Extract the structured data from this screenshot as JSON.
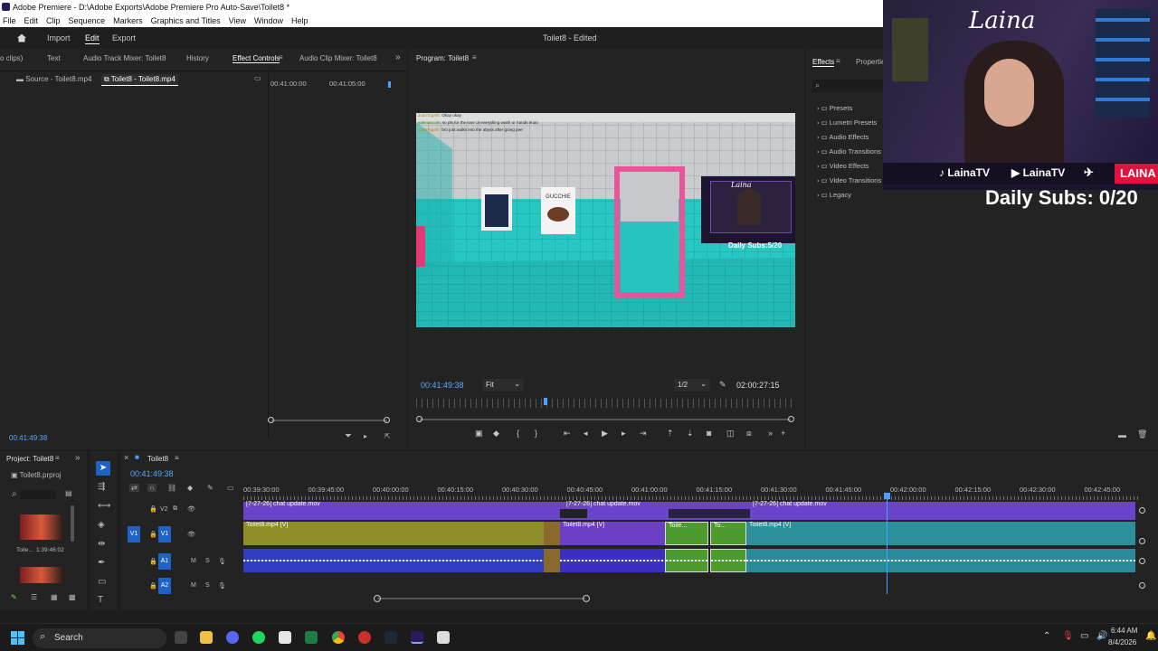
{
  "window": {
    "title": "Adobe Premiere - D:\\Adobe Exports\\Adobe Premiere Pro Auto-Save\\Toilet8 *"
  },
  "menu": [
    "File",
    "Edit",
    "Clip",
    "Sequence",
    "Markers",
    "Graphics and Titles",
    "View",
    "Window",
    "Help"
  ],
  "workspace": {
    "tabs": [
      "Import",
      "Edit",
      "Export"
    ],
    "active": "Edit",
    "sequence_title": "Toilet8 - Edited"
  },
  "left_panel": {
    "tabs": [
      "o clips)",
      "Text",
      "Audio Track Mixer: Toilet8",
      "History",
      "Effect Controls",
      "Audio Clip Mixer: Toilet8"
    ],
    "active_tab": "Effect Controls",
    "subtabs": [
      "Source - Toilet8.mp4",
      "Toilet8 - Toilet8.mp4"
    ],
    "ruler": [
      "00:41:00:00",
      "00:41:05:00"
    ],
    "timecode": "00:41:49:38"
  },
  "program": {
    "tab": "Program: Toilet8",
    "timecode": "00:41:49:38",
    "fit": "Fit",
    "resolution": "1/2",
    "duration": "02:00:27:15",
    "chat": [
      {
        "user": "JuanTogeth:",
        "msg": "Okay okay"
      },
      {
        "user": "yakmancols:",
        "msg": "so pls for the love of everything wash ur hands lmao"
      },
      {
        "user": "JuanTogeth:",
        "msg": "bro just walks into the abyss after going pee"
      }
    ],
    "poster_text": "GUCCHIE",
    "overlay_name": "Laina",
    "overlay_subs": "Daily Subs:5/20"
  },
  "effects": {
    "tabs": [
      "Effects",
      "Properties"
    ],
    "items": [
      "Presets",
      "Lumetri Presets",
      "Audio Effects",
      "Audio Transitions",
      "Video Effects",
      "Video Transitions",
      "Legacy"
    ]
  },
  "webcam": {
    "name": "Laina",
    "socials": [
      "LainaTV",
      "LainaTV",
      "LAINA"
    ],
    "daily_subs": "Daily Subs: 0/20"
  },
  "project": {
    "tab": "Project: Toilet8",
    "file": "Toilet8.prproj",
    "item_name": "Toile...",
    "item_duration": "1:39:46:02"
  },
  "timeline": {
    "tab": "Toilet8",
    "timecode": "00:41:49:38",
    "ruler": [
      "00:39:30:00",
      "00:39:45:00",
      "00:40:00:00",
      "00:40:15:00",
      "00:40:30:00",
      "00:40:45:00",
      "00:41:00:00",
      "00:41:15:00",
      "00:41:30:00",
      "00:41:45:00",
      "00:42:00:00",
      "00:42:15:00",
      "00:42:30:00",
      "00:42:45:00"
    ],
    "tracks": [
      "V2",
      "V1",
      "A1",
      "A2"
    ],
    "v2_clip": "[7-27-26] chat update.mov",
    "v1_clips": [
      "Toilet8.mp4 [V]",
      "Toilet8.mp4 [V]",
      "Toile...",
      "To...",
      "Toilet8.mp4 [V]"
    ]
  },
  "taskbar": {
    "search": "Search",
    "time": "6:44 AM",
    "date": "8/4/2026"
  }
}
